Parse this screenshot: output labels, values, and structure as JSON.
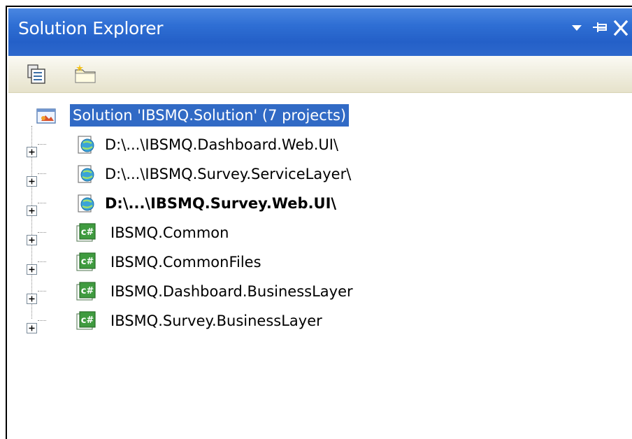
{
  "window": {
    "title": "Solution Explorer",
    "controls": [
      {
        "name": "dropdown-arrow-icon",
        "glyph": "▾"
      },
      {
        "name": "pin-icon",
        "glyph": "⊣"
      },
      {
        "name": "close-icon",
        "glyph": "✕"
      }
    ]
  },
  "toolbar": {
    "buttons": [
      {
        "name": "properties-icon"
      },
      {
        "name": "show-all-files-icon"
      }
    ]
  },
  "tree": {
    "solution": {
      "label": "Solution 'IBSMQ.Solution' (7 projects)",
      "selected": true,
      "icon": "solution-icon"
    },
    "projects": [
      {
        "label": "D:\\...\\IBSMQ.Dashboard.Web.UI\\",
        "icon": "web-project-icon",
        "bold": false
      },
      {
        "label": "D:\\...\\IBSMQ.Survey.ServiceLayer\\",
        "icon": "web-project-icon",
        "bold": false
      },
      {
        "label": "D:\\...\\IBSMQ.Survey.Web.UI\\",
        "icon": "web-project-icon",
        "bold": true
      },
      {
        "label": "IBSMQ.Common",
        "icon": "csharp-project-icon",
        "bold": false
      },
      {
        "label": "IBSMQ.CommonFiles",
        "icon": "csharp-project-icon",
        "bold": false
      },
      {
        "label": "IBSMQ.Dashboard.BusinessLayer",
        "icon": "csharp-project-icon",
        "bold": false
      },
      {
        "label": "IBSMQ.Survey.BusinessLayer",
        "icon": "csharp-project-icon",
        "bold": false
      }
    ]
  },
  "colors": {
    "titlebar": "#2d68cc",
    "selection": "#316ac5",
    "toolbar": "#f2f0e3"
  }
}
